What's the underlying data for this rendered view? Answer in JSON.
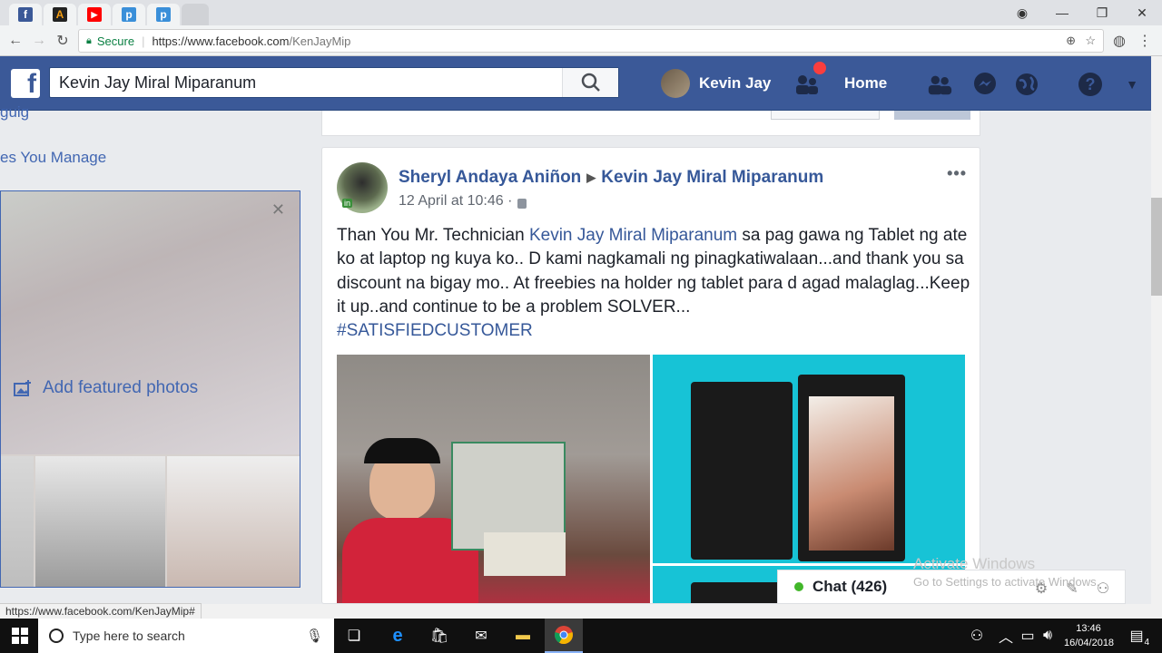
{
  "browser": {
    "tabs": [
      {
        "name": "tab-facebook",
        "letter": "f",
        "color": "#3b5998"
      },
      {
        "name": "tab-avast",
        "letter": "A",
        "color": "#f39c12"
      },
      {
        "name": "tab-youtube",
        "letter": "▶",
        "color": "#ff0000"
      },
      {
        "name": "tab-p1",
        "letter": "p",
        "color": "#3a8fd9"
      },
      {
        "name": "tab-p2",
        "letter": "p",
        "color": "#3a8fd9"
      }
    ],
    "secure_label": "Secure",
    "url_host": "https://www.facebook.com",
    "url_path": "/KenJayMip"
  },
  "facebook": {
    "search_value": "Kevin Jay Miral Miparanum",
    "user_name": "Kevin Jay",
    "home_label": "Home"
  },
  "left": {
    "partial_text": "guig",
    "pages_manage": "es You Manage",
    "add_featured": "Add featured photos"
  },
  "post": {
    "author": "Sheryl Andaya Aniñon",
    "target": "Kevin Jay Miral Miparanum",
    "date": "12 April at 10:46 ·",
    "text_before": "Than You Mr. Technician ",
    "mention": "Kevin Jay Miral Miparanum",
    "text_after": " sa pag gawa ng Tablet ng ate ko at laptop ng kuya ko.. D kami nagkamali ng pinagkatiwalaan...and thank you sa discount na bigay mo.. At freebies na holder ng tablet para d agad malaglag...Keep it up..and continue to be a problem SOLVER...",
    "hashtag": "#SATISFIEDCUSTOMER",
    "avatar_badge": "in"
  },
  "status_url": "https://www.facebook.com/KenJayMip#",
  "chat": {
    "label": "Chat (426)"
  },
  "watermark": {
    "line1": "Activate Windows",
    "line2": "Go to Settings to activate Windows."
  },
  "taskbar": {
    "search_placeholder": "Type here to search",
    "time": "13:46",
    "date": "16/04/2018",
    "notif_count": "4"
  }
}
